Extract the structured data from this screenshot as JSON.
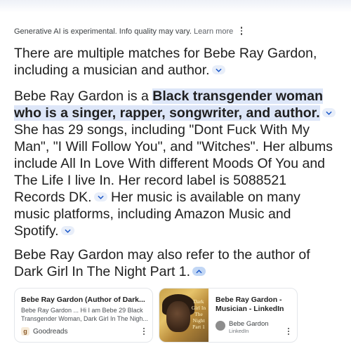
{
  "header": {
    "disclaimer": "Generative AI is experimental. Info quality may vary.",
    "learn_more": "Learn more",
    "menu_icon": "more-vert-icon"
  },
  "answer": {
    "p1": "There are multiple matches for Bebe Ray Gardon, including a musician and author.",
    "p2_lead": "Bebe Ray Gardon is a ",
    "p2_highlight": "Black transgender woman who is a singer, rapper, songwriter, and author.",
    "p2_sent2": " She has 29 songs, including \"Dont Fuck With My Man\", \"I Will Follow You\", and \"Witches\". Her albums include All In Love With different Moods Of You and The Life I live In. Her record label is 5088521 Records DK.",
    "p2_sent3": " Her music is available on many music platforms, including Amazon Music and Spotify.",
    "p3": "Bebe Ray Gardon may also refer to the author of Dark Girl In The Night Part 1."
  },
  "sources": [
    {
      "title": "Bebe Ray Gardon (Author of Dark...",
      "snippet": "Bebe Ray Gardon ... Hi I am Bebe 29 Black Transgender Woman, Dark Girl In The Nigh...",
      "site": "Goodreads",
      "favicon_letter": "g"
    },
    {
      "title": "Bebe Ray Gardon - Musician - LinkedIn",
      "author": "Bebe Gardon",
      "site": "LinkedIn",
      "thumb_text": "Dark Girl In The Night Part 1"
    }
  ],
  "colors": {
    "highlight": "#dde6f8",
    "chevron_bg": "#e8eef9",
    "chevron_active": "#c2d7f5",
    "chevron_icon": "#1a57c8"
  }
}
